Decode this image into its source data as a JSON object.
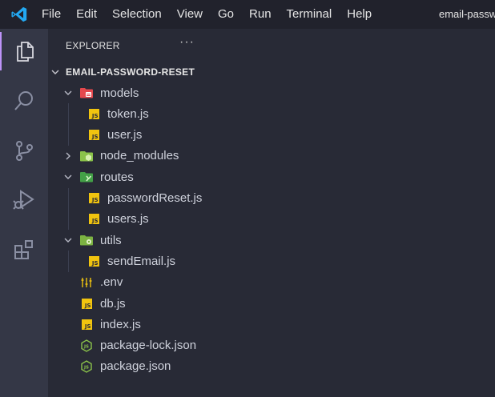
{
  "menu": [
    "File",
    "Edit",
    "Selection",
    "View",
    "Go",
    "Run",
    "Terminal",
    "Help"
  ],
  "window_title": "email-passw",
  "explorer": {
    "header": "EXPLORER",
    "more": "···",
    "root": "EMAIL-PASSWORD-RESET"
  },
  "tree": [
    {
      "label": "models",
      "kind": "folder",
      "icon": "models-folder-icon",
      "depth": 1,
      "expanded": true
    },
    {
      "label": "token.js",
      "kind": "file",
      "icon": "js-icon",
      "depth": 2
    },
    {
      "label": "user.js",
      "kind": "file",
      "icon": "js-icon",
      "depth": 2
    },
    {
      "label": "node_modules",
      "kind": "folder",
      "icon": "node-folder-icon",
      "depth": 1,
      "expanded": false
    },
    {
      "label": "routes",
      "kind": "folder",
      "icon": "routes-folder-icon",
      "depth": 1,
      "expanded": true
    },
    {
      "label": "passwordReset.js",
      "kind": "file",
      "icon": "js-icon",
      "depth": 2
    },
    {
      "label": "users.js",
      "kind": "file",
      "icon": "js-icon",
      "depth": 2
    },
    {
      "label": "utils",
      "kind": "folder",
      "icon": "utils-folder-icon",
      "depth": 1,
      "expanded": true
    },
    {
      "label": "sendEmail.js",
      "kind": "file",
      "icon": "js-icon",
      "depth": 2
    },
    {
      "label": ".env",
      "kind": "file",
      "icon": "env-icon",
      "depth": 1
    },
    {
      "label": "db.js",
      "kind": "file",
      "icon": "js-icon",
      "depth": 1
    },
    {
      "label": "index.js",
      "kind": "file",
      "icon": "js-icon",
      "depth": 1
    },
    {
      "label": "package-lock.json",
      "kind": "file",
      "icon": "nodejs-icon",
      "depth": 1
    },
    {
      "label": "package.json",
      "kind": "file",
      "icon": "nodejs-icon",
      "depth": 1
    }
  ],
  "js_badge": "JS",
  "colors": {
    "accent": "#bd93f9",
    "js": "#f1c40f",
    "models_folder": "#e5484d",
    "node_folder": "#8bc34a",
    "routes_folder": "#43a047",
    "utils_folder": "#7cb342"
  }
}
